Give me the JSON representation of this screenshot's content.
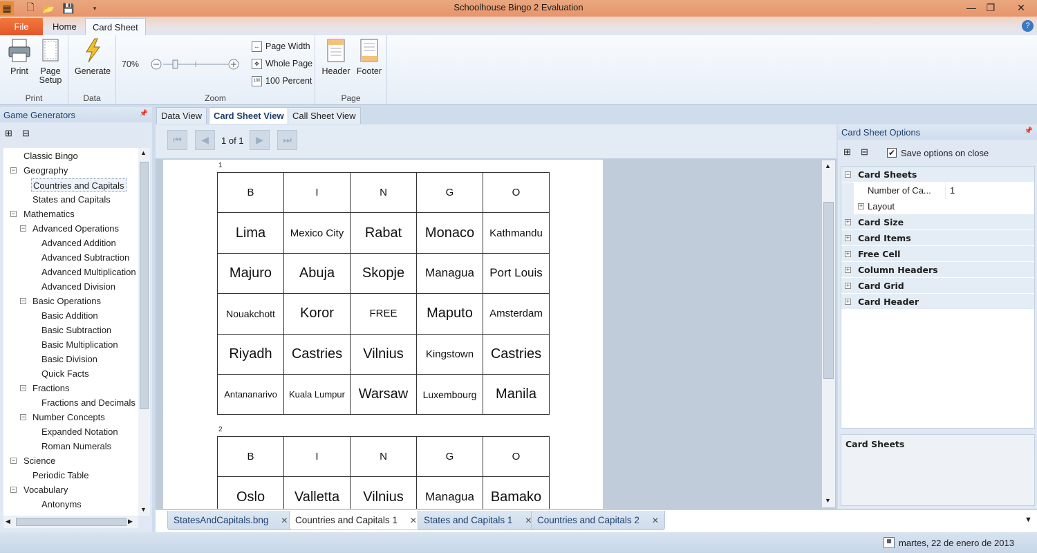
{
  "window": {
    "title": "Schoolhouse Bingo 2 Evaluation"
  },
  "ribbon_tabs": [
    "File",
    "Home",
    "Card Sheet"
  ],
  "ribbon": {
    "print_label": "Print",
    "page_setup_label": "Page Setup",
    "generate_label": "Generate",
    "zoom_value": "70%",
    "page_width_label": "Page Width",
    "whole_page_label": "Whole Page",
    "hundred_percent_label": "100 Percent",
    "header_label": "Header",
    "footer_label": "Footer",
    "groups": {
      "print": "Print",
      "data": "Data",
      "zoom": "Zoom",
      "page": "Page"
    }
  },
  "left_panel": {
    "title": "Game Generators",
    "tree": [
      "Classic Bingo",
      "Geography",
      "Countries and Capitals",
      "States and Capitals",
      "Mathematics",
      "Advanced Operations",
      "Advanced Addition",
      "Advanced Subtraction",
      "Advanced Multiplication",
      "Advanced Division",
      "Basic Operations",
      "Basic Addition",
      "Basic Subtraction",
      "Basic Multiplication",
      "Basic Division",
      "Quick Facts",
      "Fractions",
      "Fractions and Decimals",
      "Number Concepts",
      "Expanded Notation",
      "Roman Numerals",
      "Science",
      "Periodic Table",
      "Vocabulary",
      "Antonyms"
    ]
  },
  "doc_tabs": [
    "Data View",
    "Card Sheet View",
    "Call Sheet View"
  ],
  "viewer": {
    "page_indicator": "1 of 1",
    "cards": [
      {
        "number": "1",
        "headers": [
          "B",
          "I",
          "N",
          "G",
          "O"
        ],
        "rows": [
          [
            "Lima",
            "Mexico City",
            "Rabat",
            "Monaco",
            "Kathmandu"
          ],
          [
            "Majuro",
            "Abuja",
            "Skopje",
            "Managua",
            "Port Louis"
          ],
          [
            "Nouakchott",
            "Koror",
            "FREE",
            "Maputo",
            "Amsterdam"
          ],
          [
            "Riyadh",
            "Castries",
            "Vilnius",
            "Kingstown",
            "Castries"
          ],
          [
            "Antananarivo",
            "Kuala Lumpur",
            "Warsaw",
            "Luxembourg",
            "Manila"
          ]
        ]
      },
      {
        "number": "2",
        "headers": [
          "B",
          "I",
          "N",
          "G",
          "O"
        ],
        "rows": [
          [
            "Oslo",
            "Valletta",
            "Vilnius",
            "Managua",
            "Bamako"
          ]
        ]
      }
    ]
  },
  "right_panel": {
    "title": "Card Sheet Options",
    "save_options_label": "Save options on close",
    "categories": [
      {
        "label": "Card Sheets",
        "expanded": true
      },
      {
        "label": "Card Size"
      },
      {
        "label": "Card Items"
      },
      {
        "label": "Free Cell"
      },
      {
        "label": "Column Headers"
      },
      {
        "label": "Card Grid"
      },
      {
        "label": "Card Header"
      }
    ],
    "number_of_cards_label": "Number of Ca...",
    "number_of_cards_value": "1",
    "layout_label": "Layout",
    "description_title": "Card Sheets"
  },
  "bottom_tabs": [
    "StatesAndCapitals.bng",
    "Countries and Capitals 1",
    "States and Capitals 1",
    "Countries and Capitals 2"
  ],
  "status": {
    "date": "martes, 22 de enero de 2013"
  },
  "colors": {
    "file_tab": "#e4552a",
    "accent": "#1c3e6e",
    "title_bar": "#e7956a"
  }
}
